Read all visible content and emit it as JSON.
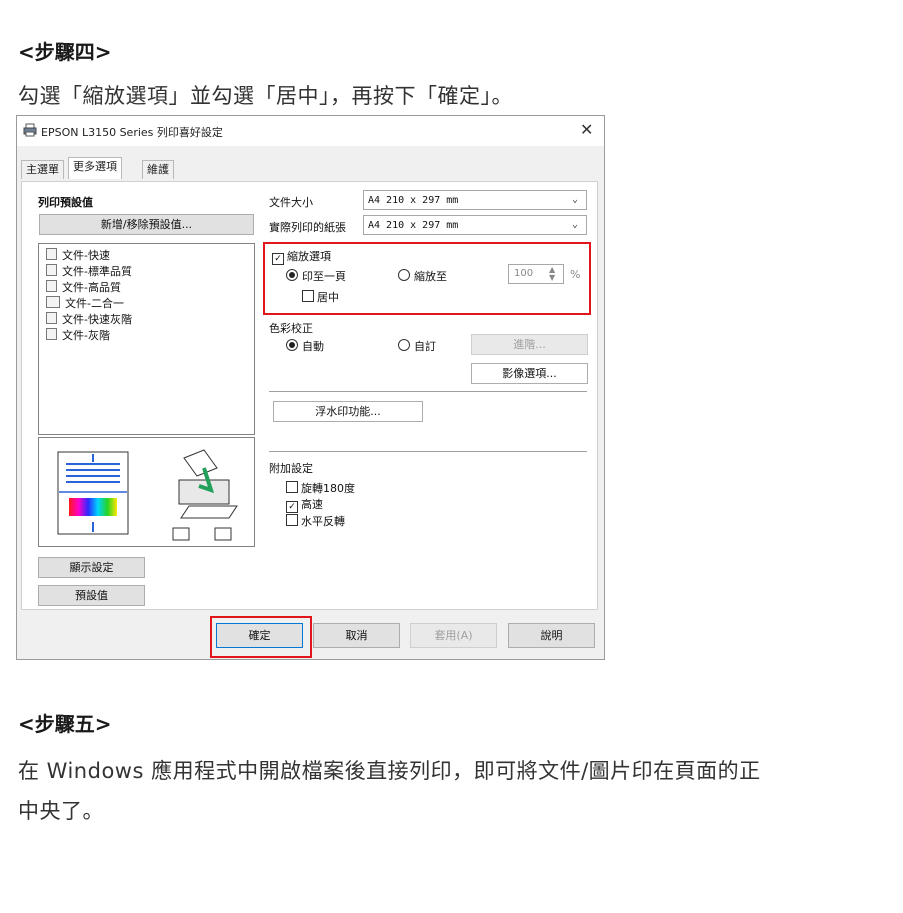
{
  "step4": {
    "heading": "<步驟四>",
    "instruction": "勾選「縮放選項」並勾選「居中」，再按下「確定」。"
  },
  "step5": {
    "heading": "<步驟五>",
    "line1": "在 Windows  應用程式中開啟檔案後直接列印，即可將文件/圖片印在頁面的正",
    "line2": "中央了。"
  },
  "dialog": {
    "title": "EPSON L3150 Series 列印喜好設定",
    "close_glyph": "✕",
    "tabs": [
      {
        "label": "主選單"
      },
      {
        "label": "更多選項"
      },
      {
        "label": "維護"
      }
    ],
    "presets": {
      "label": "列印預設值",
      "add_remove_button": "新增/移除預設值...",
      "items": [
        {
          "label": "文件-快速",
          "icon": "document-icon"
        },
        {
          "label": "文件-標準品質",
          "icon": "document-icon"
        },
        {
          "label": "文件-高品質",
          "icon": "document-icon"
        },
        {
          "label": "文件-二合一",
          "icon": "two-up-icon"
        },
        {
          "label": "文件-快速灰階",
          "icon": "document-icon"
        },
        {
          "label": "文件-灰階",
          "icon": "document-icon"
        }
      ],
      "show_settings_button": "顯示設定",
      "defaults_button": "預設值"
    },
    "paper": {
      "doc_size_label": "文件大小",
      "doc_size_value": "A4 210 x 297 mm",
      "output_paper_label": "實際列印的紙張",
      "output_paper_value": "A4 210 x 297 mm"
    },
    "scaling": {
      "checkbox_label": "縮放選項",
      "checked": true,
      "fit_page_label": "印至一頁",
      "fit_page_selected": true,
      "zoom_label": "縮放至",
      "zoom_value": "100",
      "percent": "%",
      "center_label": "居中",
      "center_checked": false
    },
    "color": {
      "label": "色彩校正",
      "auto_label": "自動",
      "auto_selected": true,
      "custom_label": "自訂",
      "advanced_button": "進階...",
      "image_options_button": "影像選項..."
    },
    "watermark_button": "浮水印功能...",
    "extra": {
      "label": "附加設定",
      "rotate_label": "旋轉180度",
      "rotate_checked": false,
      "high_speed_label": "高速",
      "high_speed_checked": true,
      "mirror_label": "水平反轉",
      "mirror_checked": false
    },
    "footer": {
      "ok": "確定",
      "cancel": "取消",
      "apply": "套用(A)",
      "help": "說明"
    },
    "colors": {
      "highlight": "#e0161b",
      "accent_blue": "#1e73d8"
    }
  }
}
